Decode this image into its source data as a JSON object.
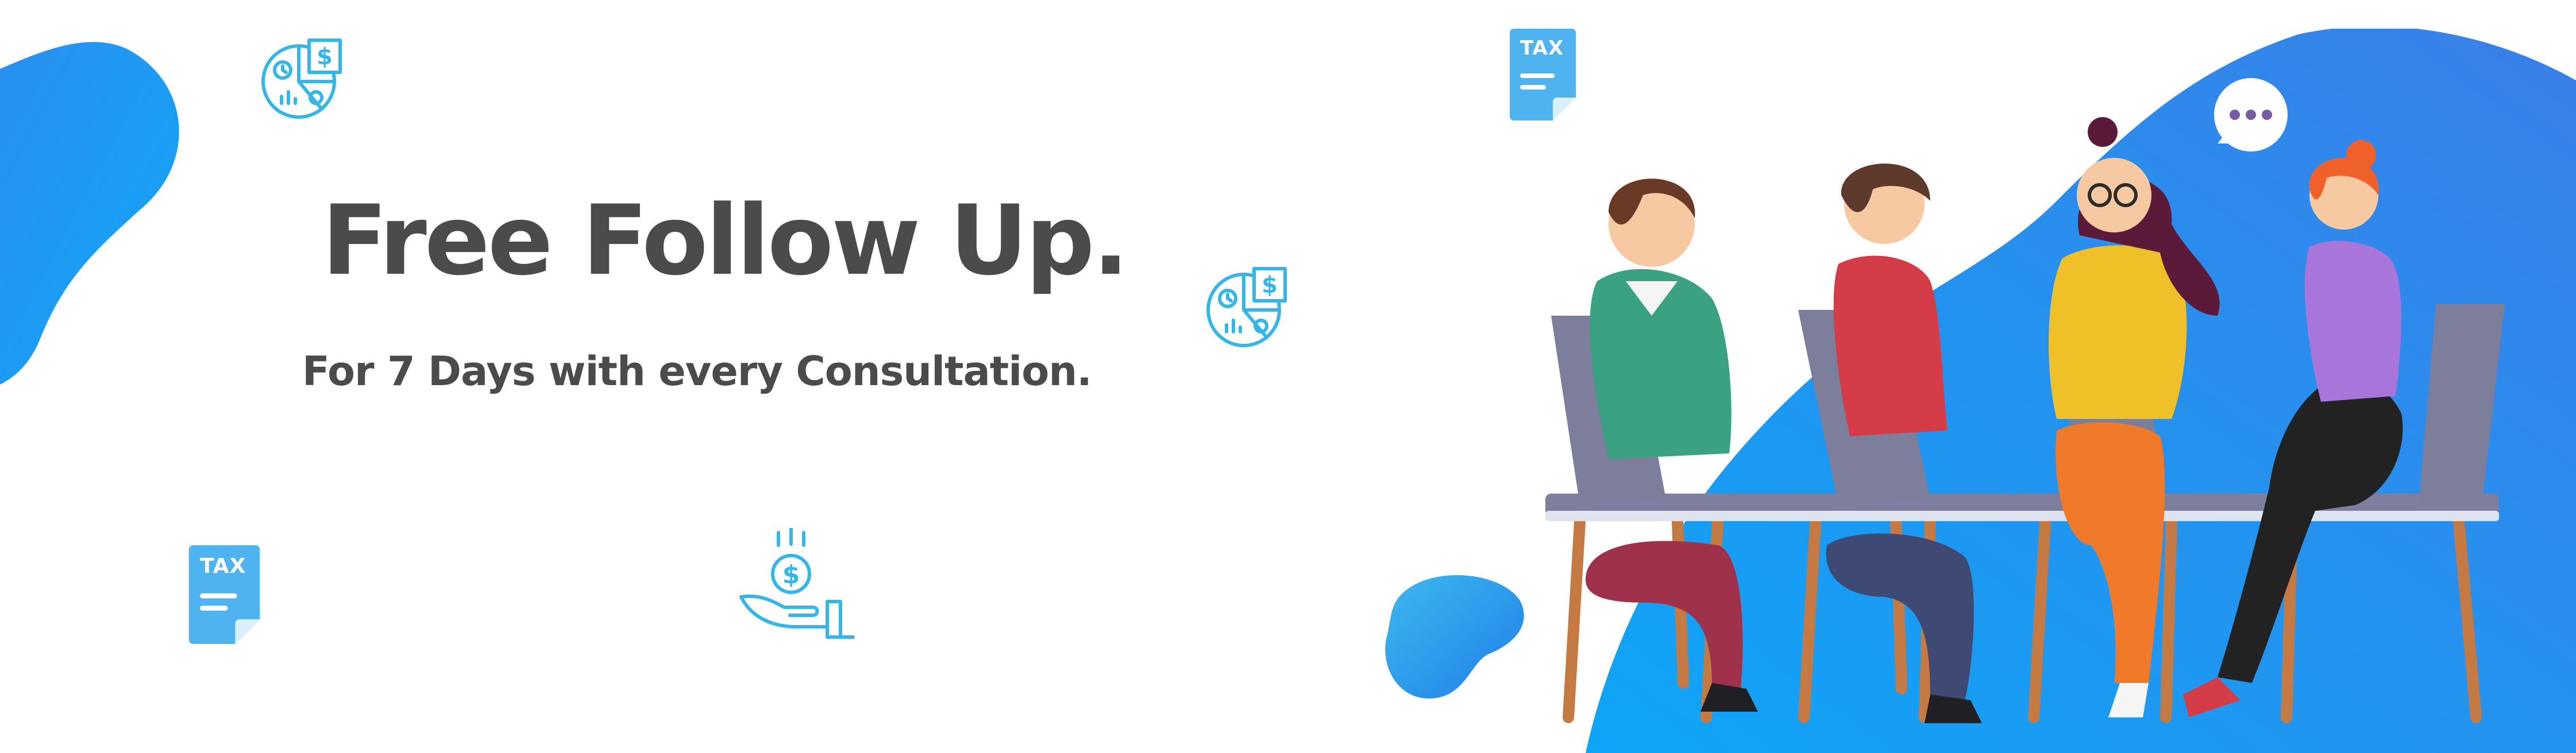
{
  "banner": {
    "headline": "Free Follow Up.",
    "subheadline": "For 7 Days with every Consultation."
  },
  "icons": {
    "tax_doc_label": "TAX",
    "chart_icon": "finance-chart-icon",
    "tax_icon": "tax-document-icon",
    "money_hand_icon": "money-hand-icon",
    "speech_icon": "speech-bubble-icon"
  },
  "colors": {
    "accent_blue": "#1e90ff",
    "icon_blue": "#35b6e6",
    "text_dark": "#4b4b4b"
  }
}
